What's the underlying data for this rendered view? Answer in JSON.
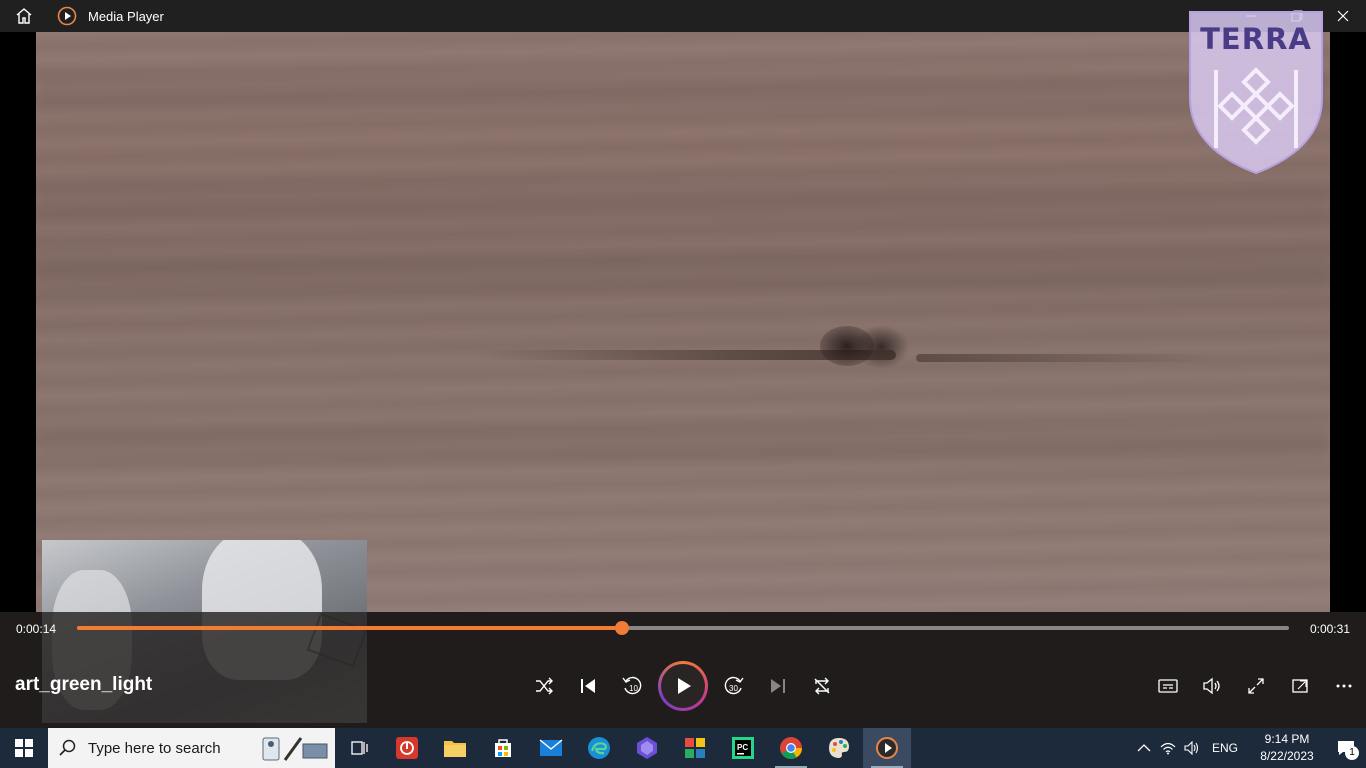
{
  "titlebar": {
    "title": "Media Player",
    "home_icon": "home-icon",
    "app_icon": "media-player-icon",
    "minimize_icon": "minimize-icon",
    "restore_icon": "restore-icon",
    "close_icon": "close-icon"
  },
  "watermark": {
    "text": "TERRA",
    "color": "#4a3b86"
  },
  "player": {
    "current_time": "0:00:14",
    "total_time": "0:00:31",
    "progress": 0.45,
    "media_title": "art_green_light",
    "accent": "#f27b35",
    "controls": [
      "shuffle-icon",
      "previous-icon",
      "rewind-10-icon",
      "play-icon",
      "forward-30-icon",
      "next-icon",
      "repeat-icon"
    ],
    "rewind_label": "10",
    "forward_label": "30",
    "right_controls": [
      "captions-icon",
      "volume-icon",
      "fullscreen-icon",
      "mini-player-icon",
      "more-icon"
    ]
  },
  "taskbar": {
    "search_placeholder": "Type here to search",
    "apps": [
      "task-view-icon",
      "app-red-icon",
      "file-explorer-icon",
      "store-icon",
      "mail-icon",
      "edge-icon",
      "app-purple-icon",
      "app-colorful-icon",
      "pycharm-icon",
      "chrome-icon",
      "paint-icon",
      "media-player-icon"
    ],
    "pycharm_label": "PC",
    "language": "ENG",
    "time": "9:14 PM",
    "date": "8/22/2023",
    "notification_count": "1"
  }
}
